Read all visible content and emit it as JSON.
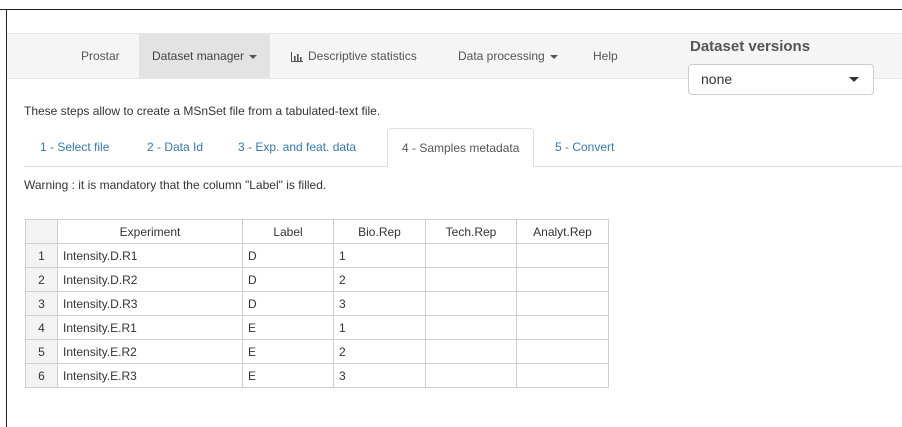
{
  "navbar": {
    "items": [
      {
        "label": "Prostar",
        "dropdown": false
      },
      {
        "label": "Dataset manager",
        "dropdown": true
      },
      {
        "label": "Descriptive statistics",
        "dropdown": false,
        "icon": "bar-chart-icon"
      },
      {
        "label": "Data processing",
        "dropdown": true
      },
      {
        "label": "Help",
        "dropdown": false
      }
    ],
    "active_index": 1
  },
  "dataset_versions": {
    "title": "Dataset versions",
    "selected": "none"
  },
  "intro_text": "These steps allow to create a MSnSet file from a tabulated-text file.",
  "tabs": [
    {
      "label": "1 - Select file"
    },
    {
      "label": "2 - Data Id"
    },
    {
      "label": "3 - Exp. and feat. data"
    },
    {
      "label": "4 - Samples metadata"
    },
    {
      "label": "5 - Convert"
    }
  ],
  "active_tab": 3,
  "warning_text": "Warning : it is mandatory that the column \"Label\" is filled.",
  "table": {
    "headers": [
      "",
      "Experiment",
      "Label",
      "Bio.Rep",
      "Tech.Rep",
      "Analyt.Rep"
    ],
    "rows": [
      [
        "1",
        "Intensity.D.R1",
        "D",
        "1",
        "",
        ""
      ],
      [
        "2",
        "Intensity.D.R2",
        "D",
        "2",
        "",
        ""
      ],
      [
        "3",
        "Intensity.D.R3",
        "D",
        "3",
        "",
        ""
      ],
      [
        "4",
        "Intensity.E.R1",
        "E",
        "1",
        "",
        ""
      ],
      [
        "5",
        "Intensity.E.R2",
        "E",
        "2",
        "",
        ""
      ],
      [
        "6",
        "Intensity.E.R3",
        "E",
        "3",
        "",
        ""
      ]
    ]
  },
  "colors": {
    "link": "#337ab7",
    "navbar_bg": "#f5f5f5",
    "active_nav_bg": "#e3e3e3"
  }
}
